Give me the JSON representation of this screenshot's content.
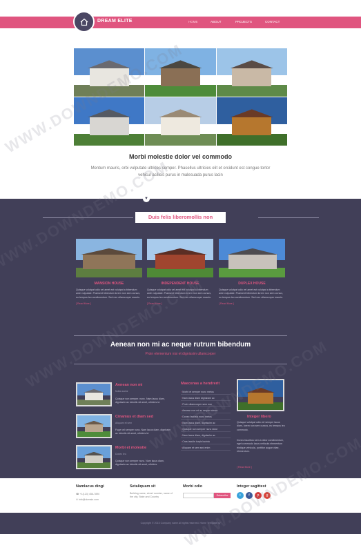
{
  "header": {
    "logo_text": "DREAM ELITE",
    "nav": [
      {
        "label": "HOME",
        "active": true
      },
      {
        "label": "ABOUT"
      },
      {
        "label": "PROJECTS"
      },
      {
        "label": "CONTACT"
      }
    ]
  },
  "hero": {
    "title": "Morbi molestie dolor vel commodo",
    "text": "Mentum mauris, orbi vulputate ultrices semper. Phasellus ultricies elit et orcidunt est congue tortor vehicul acilisis purus in malesuada purus lacin"
  },
  "featured": {
    "title": "Duis felis liberomollis non",
    "cards": [
      {
        "title": "MANSION HOUSE",
        "text": "Quisque volutpat odio vel amet est volutpat a bibendum ante vulputate. Praesent bibendum lorem non sem cursus, eu tempus leo condimentum. Sed nec ullamcorper mauris.",
        "link": "[ Read More ]"
      },
      {
        "title": "INDEPENDENT HOUSE",
        "text": "Quisque volutpat odio vel amet est volutpat a bibendum ante vulputate. Praesent bibendum lorem non sem cursus, eu tempus leo condimentum. Sed nec ullamcorper mauris.",
        "link": "[ Read More ]"
      },
      {
        "title": "DUPLEX HOUSE",
        "text": "Quisque volutpat odio vel amet est volutpat a bibendum ante vulputate. Praesent bibendum lorem non sem cursus, eu tempus leo condimentum. Sed nec ullamcorper mauris.",
        "link": "[ Read More ]"
      }
    ]
  },
  "banner": {
    "title": "Aenean non mi ac neque rutrum bibendum",
    "subtitle": "Proin elementum nisi et dignissim ullamcorper"
  },
  "posts": [
    {
      "title": "Aenean non mi",
      "date": "Nulla auctor",
      "text": "Quisque non semper. nunc. Nam lacus diam, dignissim ac lobortis sit amet, ultricies id."
    },
    {
      "title": "Cinamus et diam sed",
      "date": "Aliquam et sem",
      "text": "Fuge vel semper nunc. Nam lacus diam, dignissim ac lobortis sit amet, ultricies id."
    },
    {
      "title": "Morbi et molestie",
      "date": "Donec leo",
      "text": "Quisque non semper nunc. Nam lacus diam, dignissim ac lobortis sit amet, ultricies."
    }
  ],
  "list_column": {
    "title": "Maecenas a hendrerit",
    "items": [
      "Morbi et semper nunc metus",
      "Nam lacus diam dignissim ac",
      "Proin ullamcorper sem non",
      "Aenean non mi ac neque rutrum",
      "Donec facilisis nunc metus",
      "Nam lacus diam, dignissim ac",
      "Quisque non semper nunc dolor",
      "Nam lacus diam, dignissim ac",
      "Cras iaculis turpis lacinia",
      "Aliquam et sem sed enim"
    ]
  },
  "side_feature": {
    "title": "Integer libero",
    "text1": "Quisque volutpat odio vel semper lacus diam, lorem non sem cursus, eu tempus leo commodo.",
    "text2": "Donec faucibus sem a dolor condimentum, eget commodo lacus vehicula elementum tristique vehicula, porttitor augue vitae, elementum.",
    "link": "[ Read More ]"
  },
  "footer": {
    "col1_title": "Namlacus dingi",
    "col1_lines": [
      "+1(123) 456-7890",
      "info@domain.com"
    ],
    "col2_title": "Setaliquam sit",
    "col2_text": "Building name, street number, name of the city, State and Country",
    "col3_title": "Morbi odio",
    "subscribe_label": "Subscribe",
    "col4_title": "Integer sagittest",
    "social": [
      {
        "icon": "twitter-icon",
        "glyph": "t",
        "color": "#3aa3dc"
      },
      {
        "icon": "facebook-icon",
        "glyph": "f",
        "color": "#3b5998"
      },
      {
        "icon": "pinterest-icon",
        "glyph": "p",
        "color": "#d33a3a"
      },
      {
        "icon": "google-plus-icon",
        "glyph": "g",
        "color": "#d9453a"
      }
    ],
    "copyright": "Copyright © 2015 Company name All rights reserved. Home Template by"
  },
  "watermark": "WWW.DOWNDEMO.COM",
  "colors": {
    "accent": "#e0557f",
    "dark": "#413f58"
  }
}
